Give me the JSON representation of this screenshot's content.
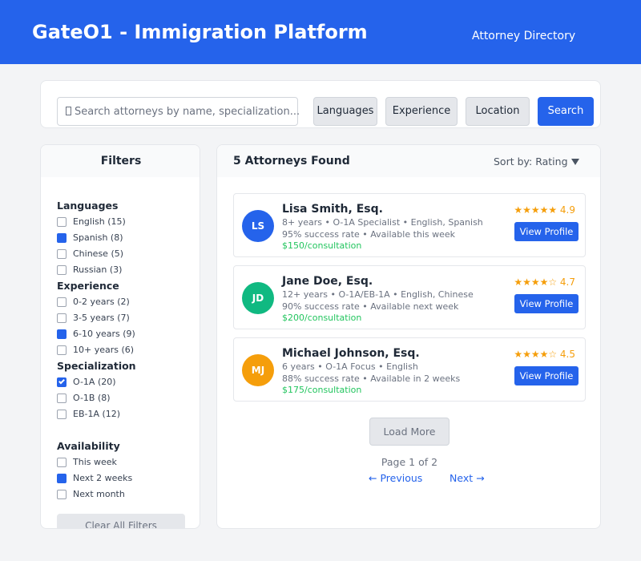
{
  "header": {
    "title": "GateO1 - Immigration Platform",
    "nav_link": "Attorney Directory",
    "background": "#2563eb"
  },
  "search": {
    "placeholder": "Search attorneys by name, specialization...",
    "buttons": [
      "Languages",
      "Experience",
      "Location"
    ],
    "search_label": "Search"
  },
  "filters": {
    "title": "Filters",
    "groups": [
      {
        "title": "Languages",
        "options": [
          {
            "label": "English (15)",
            "checked": false
          },
          {
            "label": "Spanish (8)",
            "checked": true
          },
          {
            "label": "Chinese (5)",
            "checked": false
          },
          {
            "label": "Russian (3)",
            "checked": false
          }
        ]
      },
      {
        "title": "Experience",
        "options": [
          {
            "label": "0-2 years (2)",
            "checked": false
          },
          {
            "label": "3-5 years (7)",
            "checked": false
          },
          {
            "label": "6-10 years (9)",
            "checked": true
          },
          {
            "label": "10+ years (6)",
            "checked": false
          }
        ]
      },
      {
        "title": "Specialization",
        "options": [
          {
            "label": "O-1A (20)",
            "checked": true,
            "ticked": true
          },
          {
            "label": "O-1B (8)",
            "checked": false
          },
          {
            "label": "EB-1A (12)",
            "checked": false
          }
        ]
      },
      {
        "title": "Availability",
        "options": [
          {
            "label": "This week",
            "checked": false
          },
          {
            "label": "Next 2 weeks",
            "checked": true
          },
          {
            "label": "Next month",
            "checked": false
          }
        ]
      }
    ],
    "clear_label": "Clear All Filters"
  },
  "results": {
    "title": "5 Attorneys Found",
    "sort_label": "Sort by: Rating",
    "view_profile_label": "View Profile",
    "attorneys": [
      {
        "initials": "LS",
        "avatar_color": "#2563eb",
        "name": "Lisa Smith, Esq.",
        "details": "8+ years • O-1A Specialist • English, Spanish",
        "stats": "95% success rate • Available this week",
        "price": "$150/consultation",
        "rating": "★★★★★ 4.9"
      },
      {
        "initials": "JD",
        "avatar_color": "#10b981",
        "name": "Jane Doe, Esq.",
        "details": "12+ years • O-1A/EB-1A • English, Chinese",
        "stats": "90% success rate • Available next week",
        "price": "$200/consultation",
        "rating": "★★★★☆ 4.7"
      },
      {
        "initials": "MJ",
        "avatar_color": "#f59e0b",
        "name": "Michael Johnson, Esq.",
        "details": "6 years • O-1A Focus • English",
        "stats": "88% success rate • Available in 2 weeks",
        "price": "$175/consultation",
        "rating": "★★★★☆ 4.5"
      }
    ],
    "load_more_label": "Load More",
    "page_info": "Page 1 of 2",
    "prev_label": "← Previous",
    "next_label": "Next →"
  }
}
